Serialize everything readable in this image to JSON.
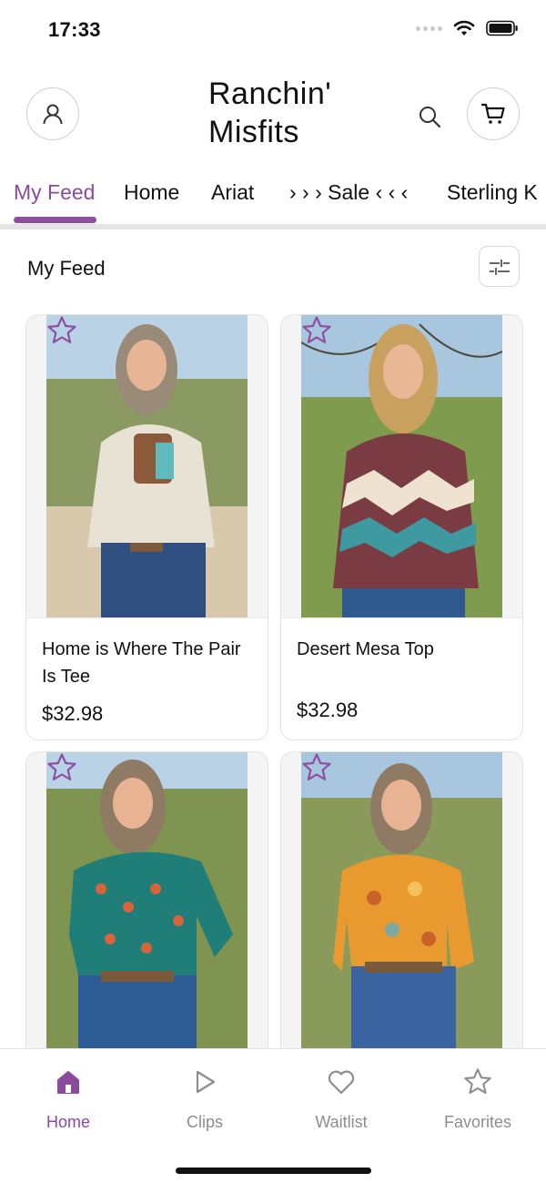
{
  "status": {
    "time": "17:33"
  },
  "header": {
    "brand": "Ranchin'\nMisfits"
  },
  "tabs": [
    {
      "label": "My Feed",
      "active": true
    },
    {
      "label": "Home",
      "active": false
    },
    {
      "label": "Ariat",
      "active": false
    },
    {
      "label": "› › › Sale ‹ ‹ ‹",
      "active": false
    },
    {
      "label": "Sterling K",
      "active": false
    }
  ],
  "feed": {
    "title": "My Feed"
  },
  "products": [
    {
      "name": "Home is Where The Pair Is Tee",
      "price": "$32.98",
      "image": "cream-graphic-tee"
    },
    {
      "name": "Desert Mesa Top",
      "price": "$32.98",
      "image": "aztec-print-top"
    },
    {
      "name": "",
      "price": "",
      "image": "teal-print-mesh-top"
    },
    {
      "name": "",
      "price": "",
      "image": "floral-orange-mesh-top"
    }
  ],
  "bottom_nav": [
    {
      "label": "Home",
      "icon": "home-icon",
      "active": true
    },
    {
      "label": "Clips",
      "icon": "play-icon",
      "active": false
    },
    {
      "label": "Waitlist",
      "icon": "heart-icon",
      "active": false
    },
    {
      "label": "Favorites",
      "icon": "star-icon",
      "active": false
    }
  ],
  "colors": {
    "accent": "#8a4a9d",
    "inactive": "#8d8d8d",
    "divider": "#e5e5e5"
  }
}
